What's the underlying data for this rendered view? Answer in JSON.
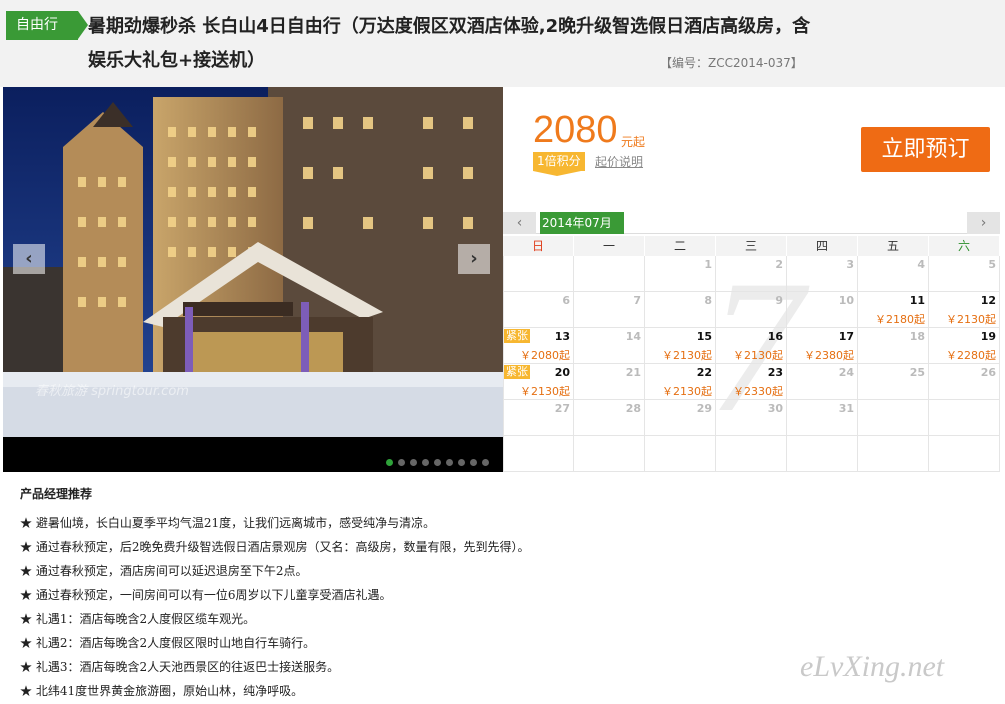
{
  "header": {
    "tag": "自由行",
    "title": "暑期劲爆秒杀 长白山4日自由行（万达度假区双酒店体验,2晚升级智选假日酒店高级房，含娱乐大礼包+接送机）",
    "code": "【编号：ZCC2014-037】"
  },
  "photo": {
    "watermark": "春秋旅游 springtour.com",
    "prev": "‹",
    "next": "›",
    "dot_count": 9,
    "active_dot": 0
  },
  "price": {
    "amount": "2080",
    "suffix": "元起",
    "points": "1倍积分",
    "desc": "起价说明",
    "book": "立即预订"
  },
  "calendar": {
    "month": "2014年07月",
    "prev": "‹",
    "next": "›",
    "watermark": "7",
    "weekdays": [
      "日",
      "一",
      "二",
      "三",
      "四",
      "五",
      "六"
    ],
    "rows": [
      [
        {
          "d": ""
        },
        {
          "d": ""
        },
        {
          "d": "1"
        },
        {
          "d": "2"
        },
        {
          "d": "3"
        },
        {
          "d": "4"
        },
        {
          "d": "5"
        }
      ],
      [
        {
          "d": "6"
        },
        {
          "d": "7"
        },
        {
          "d": "8"
        },
        {
          "d": "9"
        },
        {
          "d": "10"
        },
        {
          "d": "11",
          "p": "￥2180起"
        },
        {
          "d": "12",
          "p": "￥2130起"
        }
      ],
      [
        {
          "d": "13",
          "p": "￥2080起",
          "tag": "紧张"
        },
        {
          "d": "14"
        },
        {
          "d": "15",
          "p": "￥2130起"
        },
        {
          "d": "16",
          "p": "￥2130起"
        },
        {
          "d": "17",
          "p": "￥2380起"
        },
        {
          "d": "18"
        },
        {
          "d": "19",
          "p": "￥2280起"
        }
      ],
      [
        {
          "d": "20",
          "p": "￥2130起",
          "tag": "紧张"
        },
        {
          "d": "21"
        },
        {
          "d": "22",
          "p": "￥2130起"
        },
        {
          "d": "23",
          "p": "￥2330起"
        },
        {
          "d": "24"
        },
        {
          "d": "25"
        },
        {
          "d": "26"
        }
      ],
      [
        {
          "d": "27"
        },
        {
          "d": "28"
        },
        {
          "d": "29"
        },
        {
          "d": "30"
        },
        {
          "d": "31"
        },
        {
          "d": ""
        },
        {
          "d": ""
        }
      ],
      [
        {
          "d": ""
        },
        {
          "d": ""
        },
        {
          "d": ""
        },
        {
          "d": ""
        },
        {
          "d": ""
        },
        {
          "d": ""
        },
        {
          "d": ""
        }
      ]
    ]
  },
  "recommend": {
    "title": "产品经理推荐",
    "items": [
      "★ 避暑仙境，长白山夏季平均气温21度，让我们远离城市，感受纯净与清凉。",
      "★ 通过春秋预定，后2晚免费升级智选假日酒店景观房（又名：高级房，数量有限，先到先得）。",
      "★ 通过春秋预定，酒店房间可以延迟退房至下午2点。",
      "★ 通过春秋预定，一间房间可以有一位6周岁以下儿童享受酒店礼遇。",
      "★ 礼遇1：酒店每晚含2人度假区缆车观光。",
      "★ 礼遇2：酒店每晚含2人度假区限时山地自行车骑行。",
      "★ 礼遇3：酒店每晚含2人天池西景区的往返巴士接送服务。",
      "★ 北纬41度世界黄金旅游圈，原始山林，纯净呼吸。"
    ]
  },
  "site_mark": "eLvXing.net"
}
